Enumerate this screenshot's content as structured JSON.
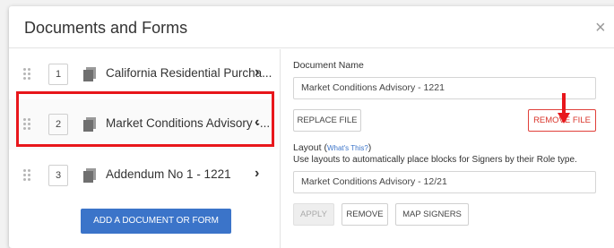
{
  "dialog": {
    "title": "Documents and Forms",
    "close_glyph": "×"
  },
  "documents": [
    {
      "number": "1",
      "name": "California Residential Purcha...",
      "chevron": "›"
    },
    {
      "number": "2",
      "name": "Market Conditions Advisory -...",
      "chevron": "‹"
    },
    {
      "number": "3",
      "name": "Addendum No 1 - 1221",
      "chevron": "›"
    }
  ],
  "add_button_label": "ADD A DOCUMENT OR FORM",
  "detail": {
    "document_name_label": "Document Name",
    "document_name_value": "Market Conditions Advisory - 1221",
    "replace_file_label": "REPLACE FILE",
    "remove_file_label": "REMOVE FILE",
    "layout_label": "Layout",
    "whats_this_link": "What's This?",
    "layout_description": "Use layouts to automatically place blocks for Signers by their Role type.",
    "layout_value": "Market Conditions Advisory - 12/21",
    "apply_label": "APPLY",
    "remove_label": "REMOVE",
    "map_signers_label": "MAP SIGNERS"
  },
  "colors": {
    "primary_button": "#3b74c9",
    "highlight": "#e8161b",
    "remove_file_accent": "#d9352b"
  }
}
